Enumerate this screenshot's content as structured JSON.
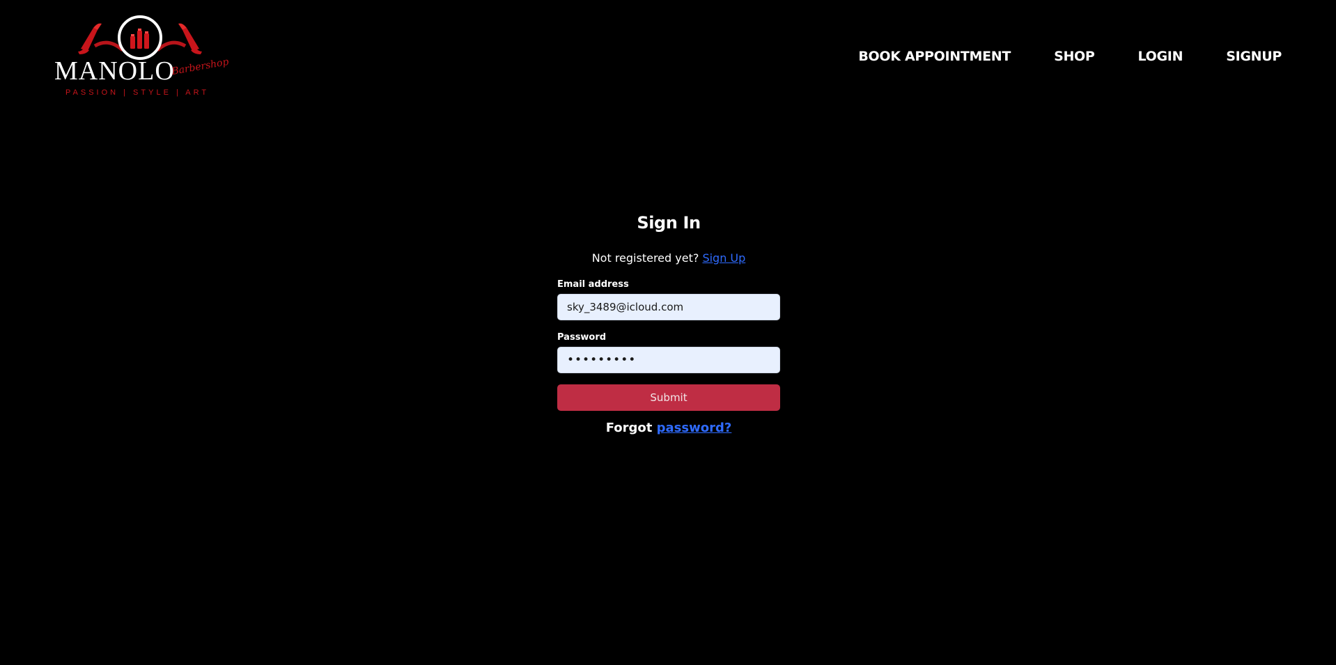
{
  "brand": {
    "name": "MANOLO",
    "script": "Barbershop",
    "tagline": "PASSION | STYLE | ART",
    "colors": {
      "accent": "#cc1a1a",
      "text": "#ffffff"
    }
  },
  "nav": {
    "items": [
      {
        "label": "BOOK APPOINTMENT"
      },
      {
        "label": "SHOP"
      },
      {
        "label": "LOGIN"
      },
      {
        "label": "SIGNUP"
      }
    ]
  },
  "form": {
    "title": "Sign In",
    "register_prompt": "Not registered yet?",
    "register_link": "Sign Up",
    "email": {
      "label": "Email address",
      "value": "sky_3489@icloud.com"
    },
    "password": {
      "label": "Password",
      "value": "•••••••••"
    },
    "submit_label": "Submit",
    "forgot_prefix": "Forgot",
    "forgot_link": "password?",
    "colors": {
      "submit": "#bf2d44",
      "link": "#2f6bff",
      "input_bg": "#e8f0fe"
    }
  }
}
